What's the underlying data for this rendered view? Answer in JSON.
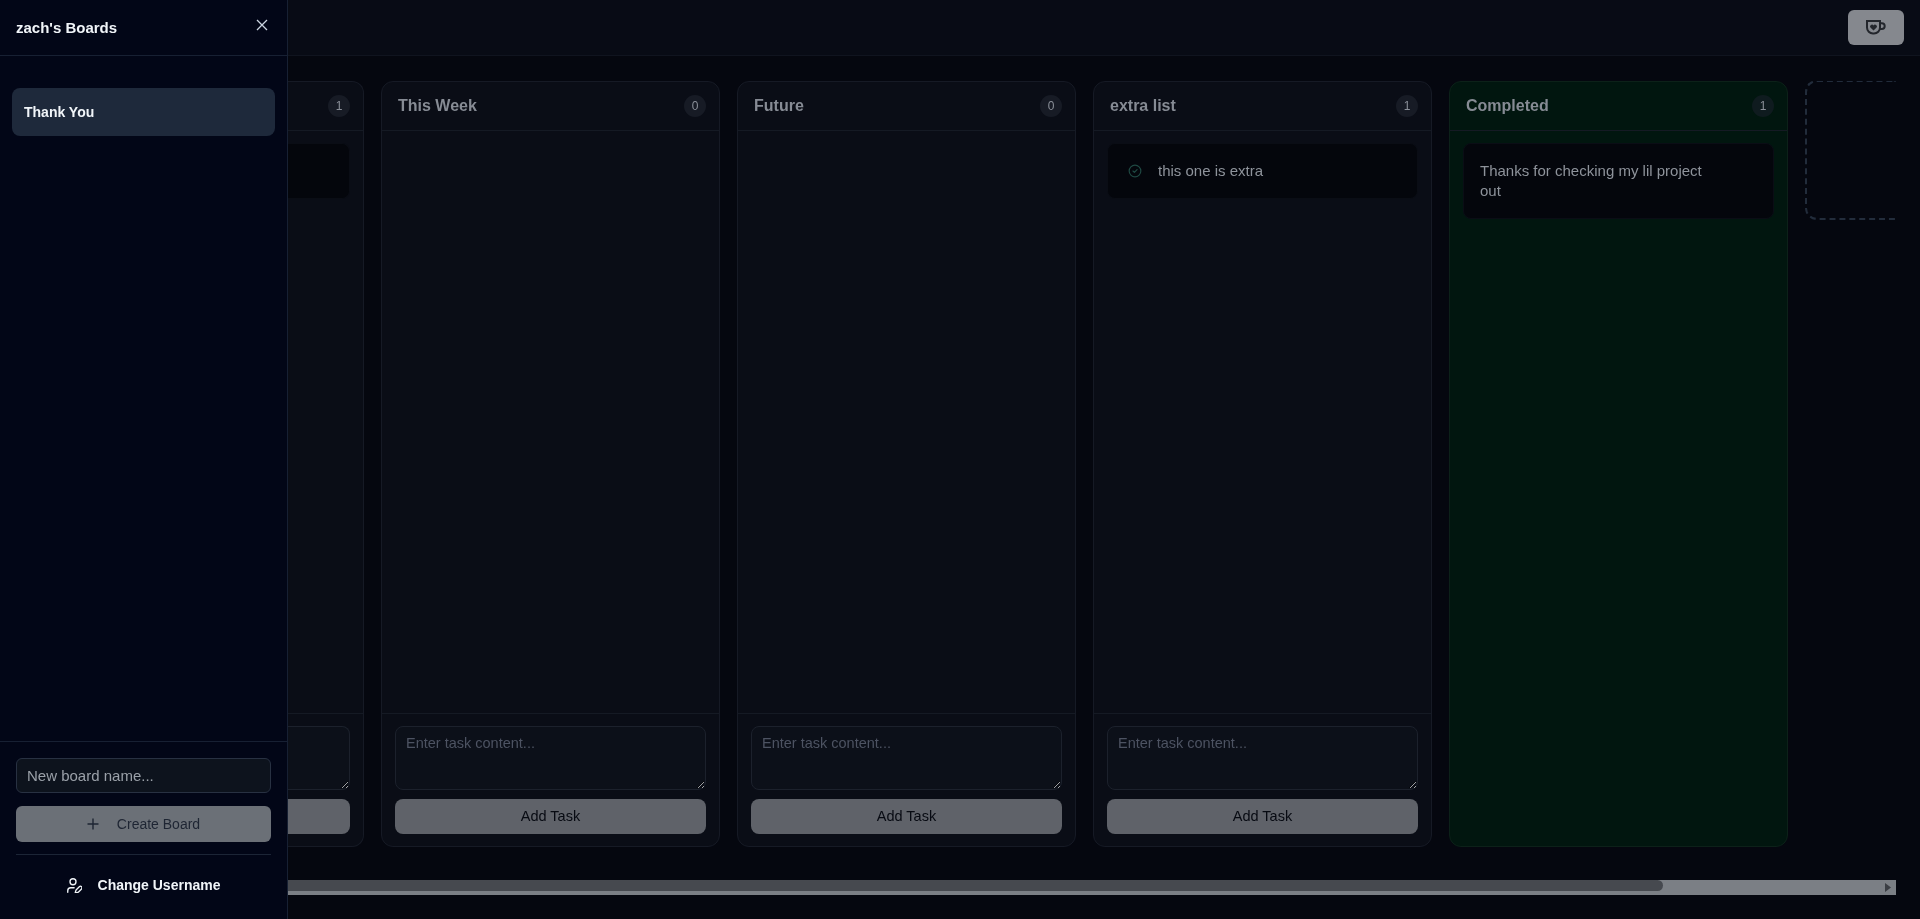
{
  "sidebar": {
    "title": "zach's Boards",
    "boards": [
      {
        "name": "Thank You",
        "selected": true
      }
    ],
    "new_board": {
      "placeholder": "New board name..."
    },
    "create_button": "Create Board",
    "change_username": "Change Username"
  },
  "columns": [
    {
      "kind": "list",
      "clipped": true,
      "count": "1",
      "tasks": [
        {
          "clipped": true
        }
      ]
    },
    {
      "kind": "list",
      "clipped": false,
      "title": "This Week",
      "count": "0",
      "task_input": {
        "placeholder": "Enter task content..."
      },
      "add_button": "Add Task"
    },
    {
      "kind": "list",
      "clipped": false,
      "title": "Future",
      "count": "0",
      "task_input": {
        "placeholder": "Enter task content..."
      },
      "add_button": "Add Task"
    },
    {
      "kind": "list",
      "clipped": false,
      "title": "extra list",
      "count": "1",
      "tasks": [
        {
          "clipped": false,
          "text": "this one is extra"
        }
      ],
      "task_input": {
        "placeholder": "Enter task content..."
      },
      "add_button": "Add Task"
    },
    {
      "kind": "completed",
      "clipped": false,
      "title": "Completed",
      "count": "1",
      "tasks": [
        {
          "clipped": false,
          "text": "Thanks for checking my lil project out"
        }
      ]
    }
  ]
}
